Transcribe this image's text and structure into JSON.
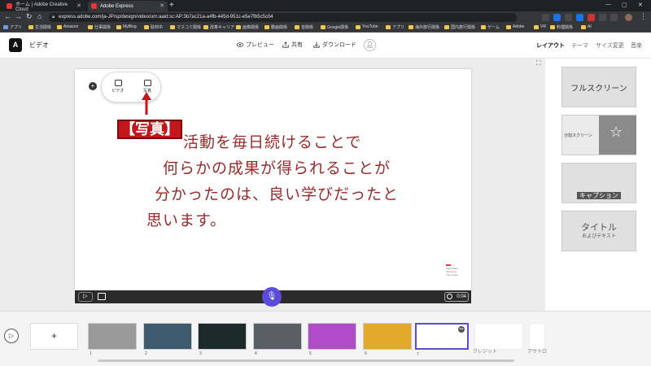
{
  "browser": {
    "tabs": [
      {
        "title": "ホーム | Adobe Creative Cloud",
        "color": "#e33"
      },
      {
        "title": "Adobe Express",
        "color": "#e33"
      }
    ],
    "url": "express.adobe.com/ja-JP/sp/design/video/urn:aaid:sc:AP:3b7ac21a-a4fb-445d-951c-e5e7fb5c5c04",
    "bookmarks": [
      "アプリ",
      "生活関係",
      "Amazon",
      "仕事関係",
      "MyBlog",
      "取材中",
      "マスコミ関係",
      "改革キャリア",
      "画像関係",
      "動画関係",
      "音関係",
      "Google関係",
      "YouTube",
      "アプリ",
      "海外旅行関係",
      "国内旅行関係",
      "ゲーム",
      "Adobe",
      "VR",
      "料理関係",
      "AI"
    ]
  },
  "header": {
    "logo": "A",
    "project_title": "ビデオ",
    "preview": "プレビュー",
    "share": "共有",
    "download": "ダウンロード",
    "right_tabs": [
      "レイアウト",
      "テーマ",
      "サイズ変更",
      "音楽"
    ]
  },
  "canvas": {
    "popup_video": "ビデオ",
    "popup_photo": "写真",
    "callout": "【写真】",
    "caption_lines": [
      "活動を毎日続けることで",
      "何らかの成果が得られることが",
      "分かったのは、良い学びだったと",
      "思います。"
    ],
    "watermark": "Ideal Ways Achieving Your Goals",
    "time": "0:04"
  },
  "layouts": [
    {
      "label": "フルスクリーン"
    },
    {
      "label": "分割スクリーン"
    },
    {
      "label": "キャプション"
    },
    {
      "label": "タイトル",
      "sub": "およびテキスト"
    }
  ],
  "timeline": {
    "add": "+",
    "scenes": [
      {
        "num": "1",
        "bg": "#9a9a9a"
      },
      {
        "num": "2",
        "bg": "#3d5a6e"
      },
      {
        "num": "3",
        "bg": "#1d2a2a"
      },
      {
        "num": "4",
        "bg": "#5a5f66"
      },
      {
        "num": "5",
        "bg": "#b04cc8"
      },
      {
        "num": "6",
        "bg": "#e3a92a"
      },
      {
        "num": "7",
        "bg": "#ffffff"
      }
    ],
    "credit_label": "クレジット",
    "outro_label": "アウトロ"
  },
  "colors": {
    "accent": "#5a4bd8",
    "caption": "#9b2a2a",
    "callout": "#c0161c"
  }
}
